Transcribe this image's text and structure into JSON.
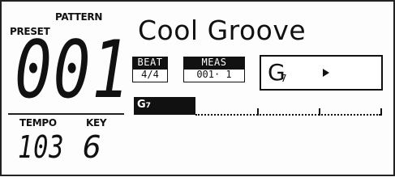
{
  "labels": {
    "pattern": "PATTERN",
    "preset": "PRESET",
    "tempo": "TEMPO",
    "key": "KEY"
  },
  "preset_number": "001",
  "tempo_value": "103",
  "key_value": "6",
  "song_title": "Cool Groove",
  "beat": {
    "label": "BEAT",
    "value": "4/4"
  },
  "meas": {
    "label": "MEAS",
    "value": "001· 1"
  },
  "chord": {
    "name": "G",
    "extension": "7",
    "play_icon": "play-icon"
  },
  "track": {
    "chord_name": "G",
    "chord_extension": "7"
  },
  "colors": {
    "lcd_background": "#fdfdfd",
    "segment_ink": "#111111"
  }
}
